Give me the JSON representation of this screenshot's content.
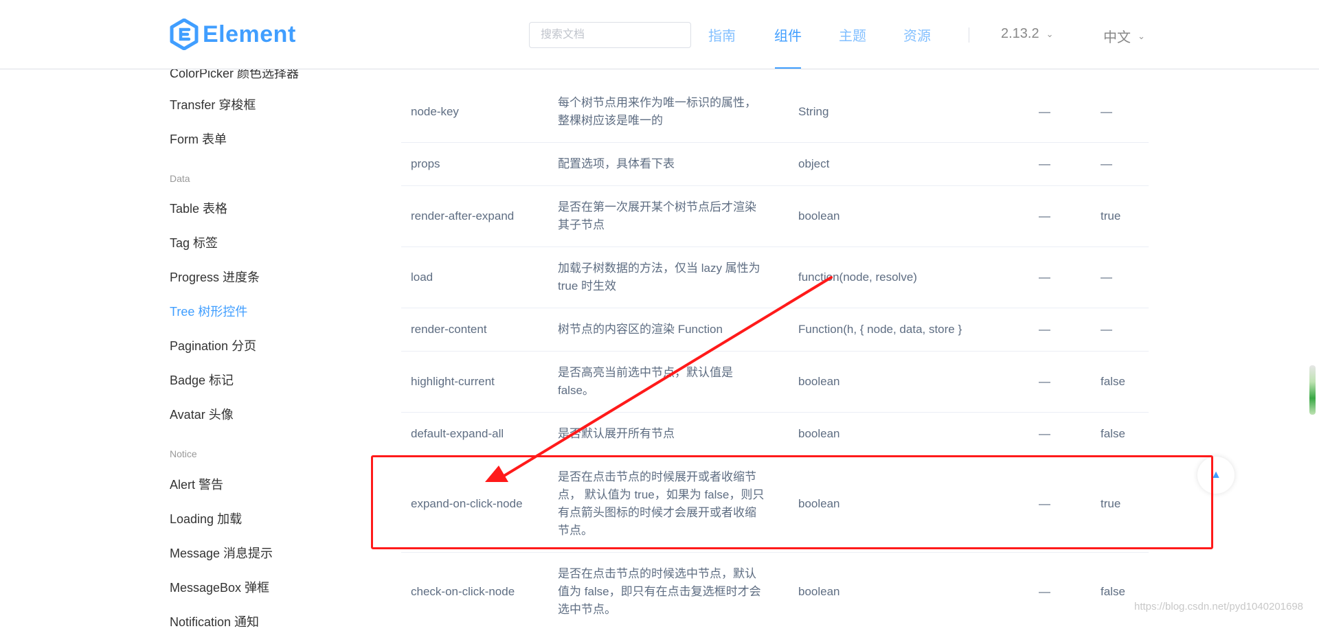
{
  "header": {
    "logo_text": "Element",
    "search_placeholder": "搜索文档",
    "nav": [
      "指南",
      "组件",
      "主题",
      "资源"
    ],
    "version": "2.13.2",
    "language": "中文"
  },
  "sidebar": {
    "cut_top_item": "ColorPicker 颜色选择器",
    "items_a": [
      "Transfer 穿梭框",
      "Form 表单"
    ],
    "group_data": "Data",
    "items_b": [
      "Table 表格",
      "Tag 标签",
      "Progress 进度条",
      "Tree 树形控件",
      "Pagination 分页",
      "Badge 标记",
      "Avatar 头像"
    ],
    "active_item": "Tree 树形控件",
    "group_notice": "Notice",
    "items_c": [
      "Alert 警告",
      "Loading 加载",
      "Message 消息提示",
      "MessageBox 弹框",
      "Notification 通知"
    ]
  },
  "table": {
    "rows": [
      {
        "param": "node-key",
        "desc1": "每个树节点用来作为唯一标识的属性，",
        "desc2": "整棵树应该是唯一的",
        "desc3": "",
        "desc4": "",
        "type": "String",
        "options": "—",
        "default": "—"
      },
      {
        "param": "props",
        "desc1": "配置选项，具体看下表",
        "desc2": "",
        "desc3": "",
        "desc4": "",
        "type": "object",
        "options": "—",
        "default": "—"
      },
      {
        "param": "render-after-expand",
        "desc1": "是否在第一次展开某个树节点后才渲染",
        "desc2": "其子节点",
        "desc3": "",
        "desc4": "",
        "type": "boolean",
        "options": "—",
        "default": "true"
      },
      {
        "param": "load",
        "desc1": "加载子树数据的方法，仅当 lazy 属性为",
        "desc2": "true 时生效",
        "desc3": "",
        "desc4": "",
        "type": "function(node, resolve)",
        "options": "—",
        "default": "—"
      },
      {
        "param": "render-content",
        "desc1": "树节点的内容区的渲染 Function",
        "desc2": "",
        "desc3": "",
        "desc4": "",
        "type": "Function(h, { node, data, store }",
        "options": "—",
        "default": "—"
      },
      {
        "param": "highlight-current",
        "desc1": "是否高亮当前选中节点，默认值是",
        "desc2": "false。",
        "desc3": "",
        "desc4": "",
        "type": "boolean",
        "options": "—",
        "default": "false"
      },
      {
        "param": "default-expand-all",
        "desc1": "是否默认展开所有节点",
        "desc2": "",
        "desc3": "",
        "desc4": "",
        "type": "boolean",
        "options": "—",
        "default": "false"
      },
      {
        "param": "expand-on-click-node",
        "desc1": "是否在点击节点的时候展开或者收缩节",
        "desc2": "点， 默认值为 true，如果为 false，则只",
        "desc3": "有点箭头图标的时候才会展开或者收缩",
        "desc4": "节点。",
        "type": "boolean",
        "options": "—",
        "default": "true"
      },
      {
        "param": "check-on-click-node",
        "desc1": "是否在点击节点的时候选中节点，默认",
        "desc2": "值为 false，即只有在点击复选框时才会",
        "desc3": "选中节点。",
        "desc4": "",
        "type": "boolean",
        "options": "—",
        "default": "false"
      }
    ]
  },
  "watermark": "https://blog.csdn.net/pyd1040201698",
  "colors": {
    "accent": "#409eff",
    "annotation": "#ff1a1a"
  }
}
